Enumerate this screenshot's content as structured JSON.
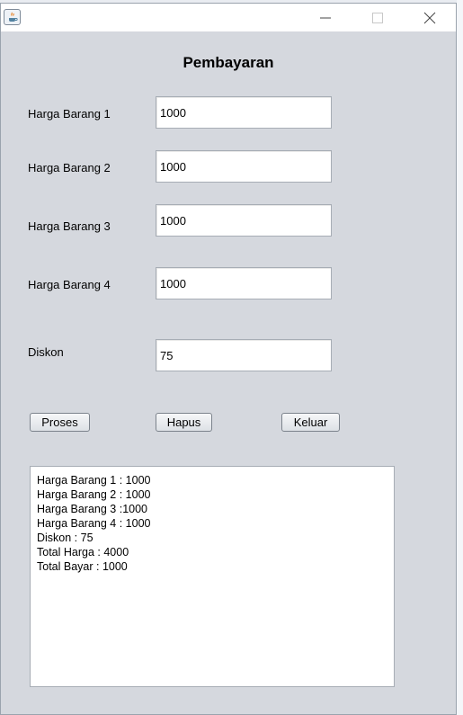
{
  "window": {
    "title": "",
    "controls": {
      "minimize": "minimize-icon",
      "maximize": "maximize-icon",
      "close": "close-icon"
    },
    "app_icon": "java-icon"
  },
  "form": {
    "heading": "Pembayaran",
    "fields": [
      {
        "label": "Harga Barang 1",
        "value": "1000"
      },
      {
        "label": "Harga Barang 2",
        "value": "1000"
      },
      {
        "label": "Harga Barang 3",
        "value": "1000"
      },
      {
        "label": "Harga Barang 4",
        "value": "1000"
      },
      {
        "label": "Diskon",
        "value": "75"
      }
    ],
    "buttons": {
      "proses": "Proses",
      "hapus": "Hapus",
      "keluar": "Keluar"
    },
    "output_lines": [
      "Harga Barang 1 : 1000",
      "Harga Barang 2 : 1000",
      "Harga Barang 3 :1000",
      "Harga Barang 4 : 1000",
      "Diskon : 75",
      "Total Harga : 4000",
      "Total Bayar : 1000"
    ]
  },
  "colors": {
    "panel": "#d5d8de",
    "titlebar": "#ffffff",
    "field_border": "#a7adb5"
  }
}
